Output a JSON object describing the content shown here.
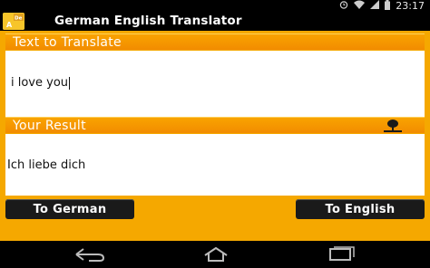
{
  "status_bar": {
    "time": "23:17",
    "icons": [
      "alarm-icon",
      "wifi-icon",
      "signal-icon",
      "battery-icon"
    ]
  },
  "action_bar": {
    "app_title": "German English Translator",
    "icon_label_de": "De",
    "icon_label_a": "A"
  },
  "input_section": {
    "header": "Text to Translate",
    "value": "i love you"
  },
  "result_section": {
    "header": "Your Result",
    "value": "Ich liebe dich",
    "mic_icon": "microphone-icon"
  },
  "buttons": {
    "to_german": "To German",
    "to_english": "To English"
  },
  "nav_bar": {
    "icons": [
      "back-icon",
      "home-icon",
      "recent-apps-icon"
    ]
  },
  "colors": {
    "accent": "#f5a800",
    "header": "#f28c00",
    "button": "#1a1a1a"
  }
}
